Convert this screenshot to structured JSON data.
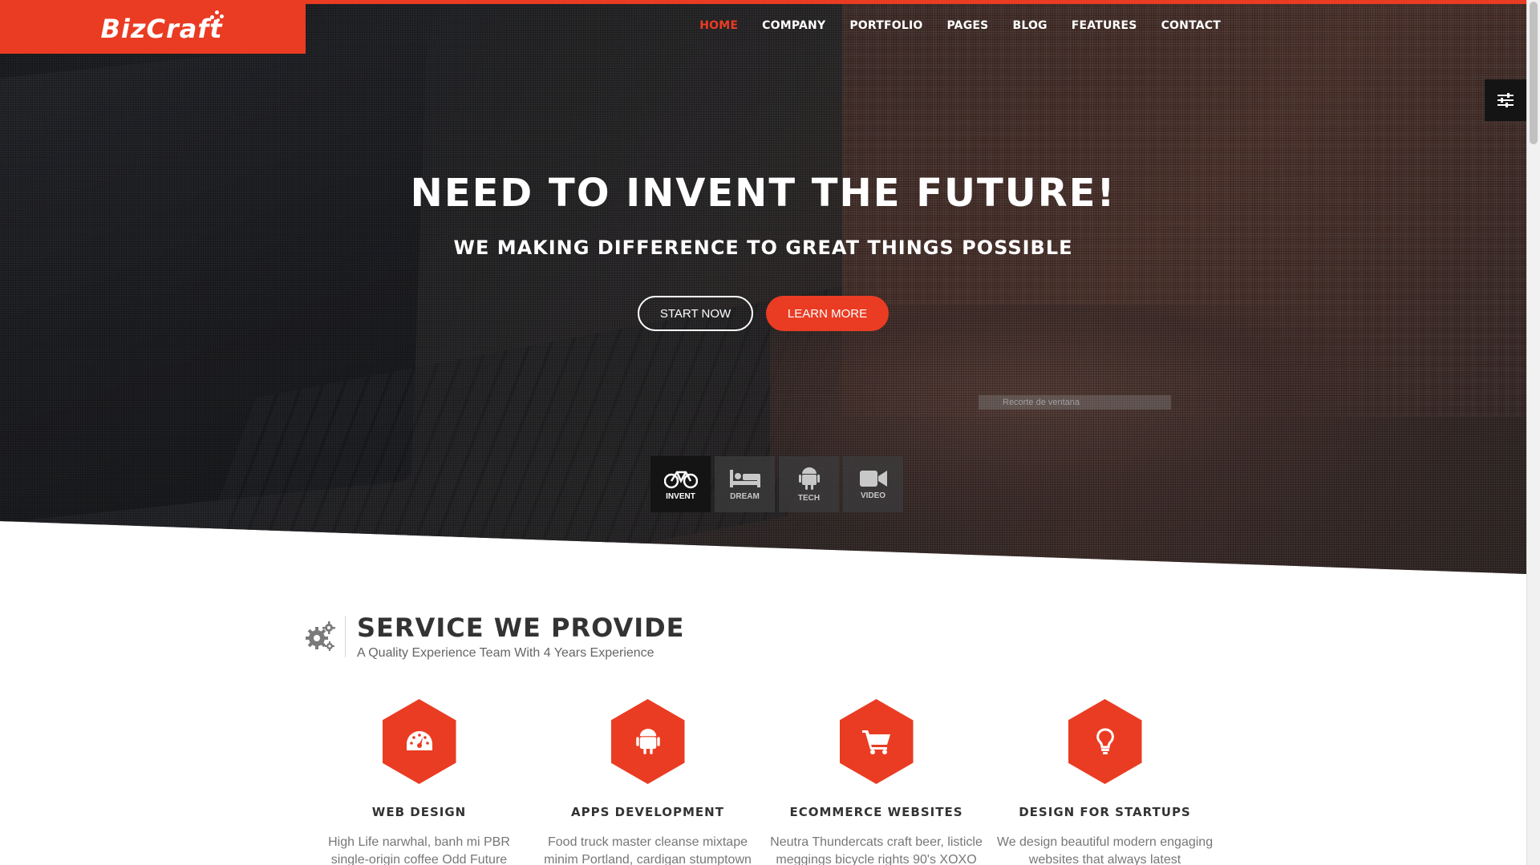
{
  "brand": {
    "name": "BizCraft",
    "color": "#ea3c23"
  },
  "nav": {
    "items": [
      {
        "label": "HOME",
        "active": true
      },
      {
        "label": "COMPANY",
        "active": false
      },
      {
        "label": "PORTFOLIO",
        "active": false
      },
      {
        "label": "PAGES",
        "active": false
      },
      {
        "label": "BLOG",
        "active": false
      },
      {
        "label": "FEATURES",
        "active": false
      },
      {
        "label": "CONTACT",
        "active": false
      }
    ]
  },
  "settings": {
    "icon": "sliders-icon"
  },
  "hero": {
    "title": "NEED TO INVENT THE FUTURE!",
    "subtitle": "WE MAKING DIFFERENCE TO GREAT THINGS POSSIBLE",
    "start_label": "START NOW",
    "learn_label": "LEARN MORE",
    "window_tip": "Recorte de ventana",
    "tabs": [
      {
        "label": "INVENT",
        "icon": "bicycle-icon",
        "active": true
      },
      {
        "label": "DREAM",
        "icon": "bed-icon",
        "active": false
      },
      {
        "label": "TECH",
        "icon": "android-icon",
        "active": false
      },
      {
        "label": "VIDEO",
        "icon": "video-camera-icon",
        "active": false
      }
    ]
  },
  "services_section": {
    "icon": "gears-icon",
    "title": "SERVICE WE PROVIDE",
    "subtitle": "A Quality Experience Team With 4 Years Experience",
    "items": [
      {
        "title": "WEB DESIGN",
        "icon": "dashboard-icon",
        "text": "High Life narwhal, banh mi PBR single-origin coffee Odd Future actually"
      },
      {
        "title": "APPS DEVELOPMENT",
        "icon": "android-icon",
        "text": "Food truck master cleanse mixtape minim Portland, cardigan stumptown"
      },
      {
        "title": "ECOMMERCE WEBSITES",
        "icon": "shopping-cart-icon",
        "text": "Neutra Thundercats craft beer, listicle meggings bicycle rights 90's XOXO"
      },
      {
        "title": "DESIGN FOR STARTUPS",
        "icon": "lightbulb-icon",
        "text": "We design beautiful modern engaging websites that always latest responsive"
      }
    ]
  }
}
